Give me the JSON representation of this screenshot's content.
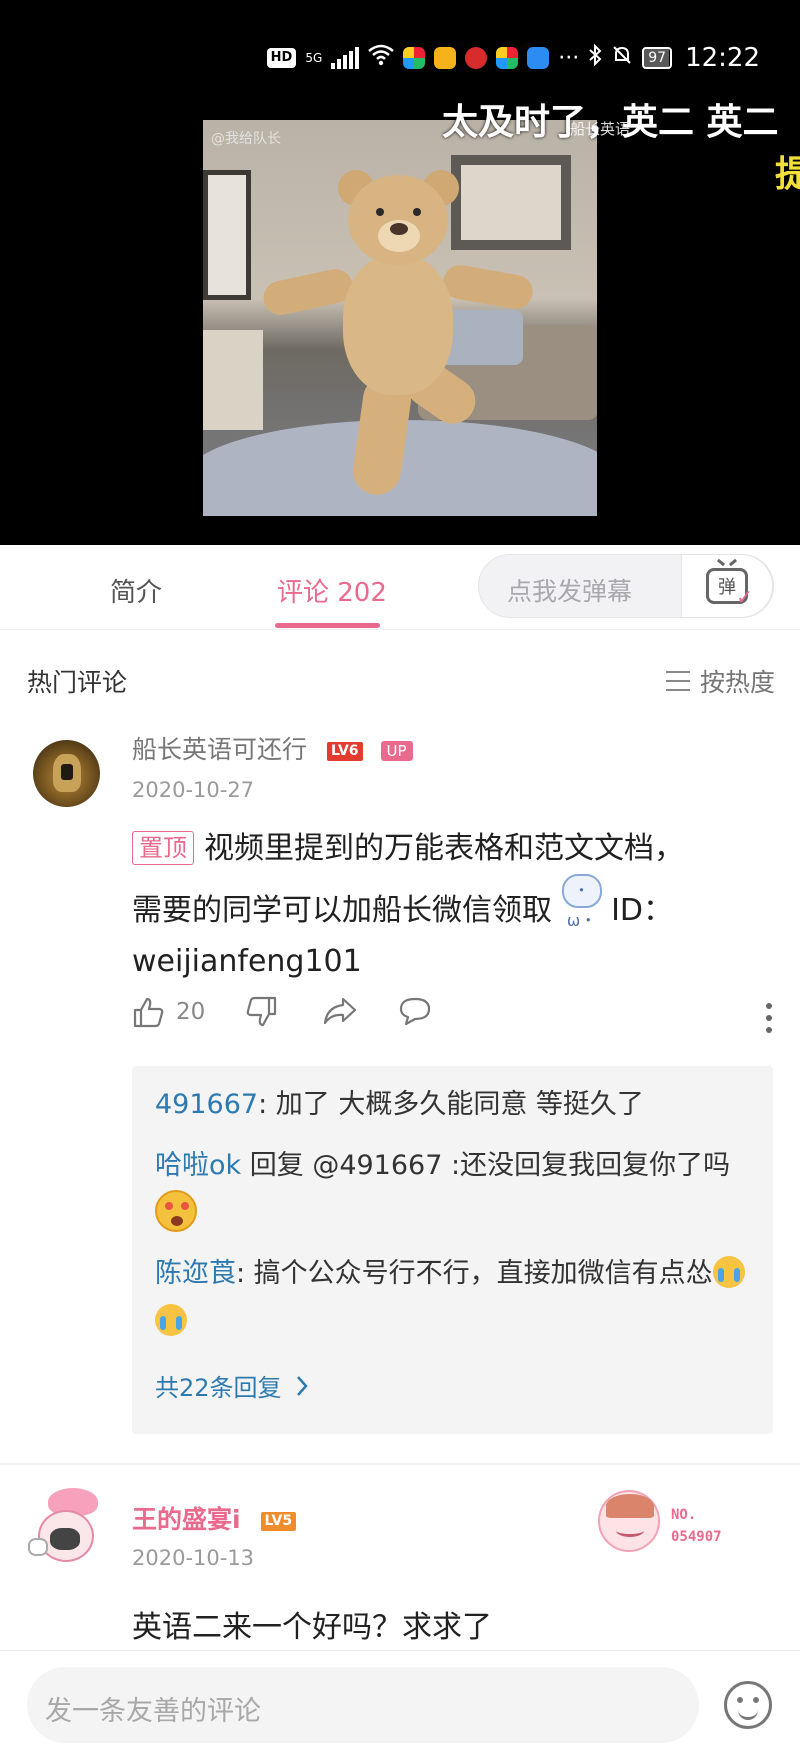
{
  "status_bar": {
    "hd": "HD",
    "network": "5G",
    "battery": "97",
    "battery_level": 0.97,
    "time": "12:22",
    "more": "···"
  },
  "video": {
    "danmaku": [
      "太及时了，英二 英二",
      "船长英语",
      "提"
    ],
    "watermark": "@我给队长"
  },
  "tabs": {
    "intro": "简介",
    "comments": "评论 202",
    "danmaku_placeholder": "点我发弹幕",
    "danmaku_button": "弹"
  },
  "comments_header": {
    "title": "热门评论",
    "sort": "按热度"
  },
  "comments": [
    {
      "user": "船长英语可还行",
      "level": "LV6",
      "badge": "UP",
      "date": "2020-10-27",
      "pin": "置顶",
      "text_line1": "视频里提到的万能表格和范文文档，",
      "text_line2": "需要的同学可以加船长微信领取",
      "text_id": " ID：",
      "text_line3": "weijianfeng101",
      "likes": "20",
      "replies": [
        {
          "user": "491667",
          "text": ": 加了 大概多久能同意 等挺久了"
        },
        {
          "user": "哈啦ok",
          "text": " 回复 @491667 :还没回复我回复你了吗 "
        },
        {
          "user": "陈迩莨",
          "text": ": 搞个公众号行不行，直接加微信有点怂"
        }
      ],
      "more_replies": "共22条回复"
    },
    {
      "user": "王的盛宴i",
      "level": "LV5",
      "date": "2020-10-13",
      "fan_no_label": "NO.",
      "fan_no": "054907",
      "text": "英语二来一个好吗？求求了"
    }
  ],
  "bottom": {
    "placeholder": "发一条友善的评论"
  },
  "colors": {
    "accent": "#ea6a8e",
    "link": "#2d7ab0",
    "level6": "#e33b2f",
    "level5": "#f08c2c"
  }
}
